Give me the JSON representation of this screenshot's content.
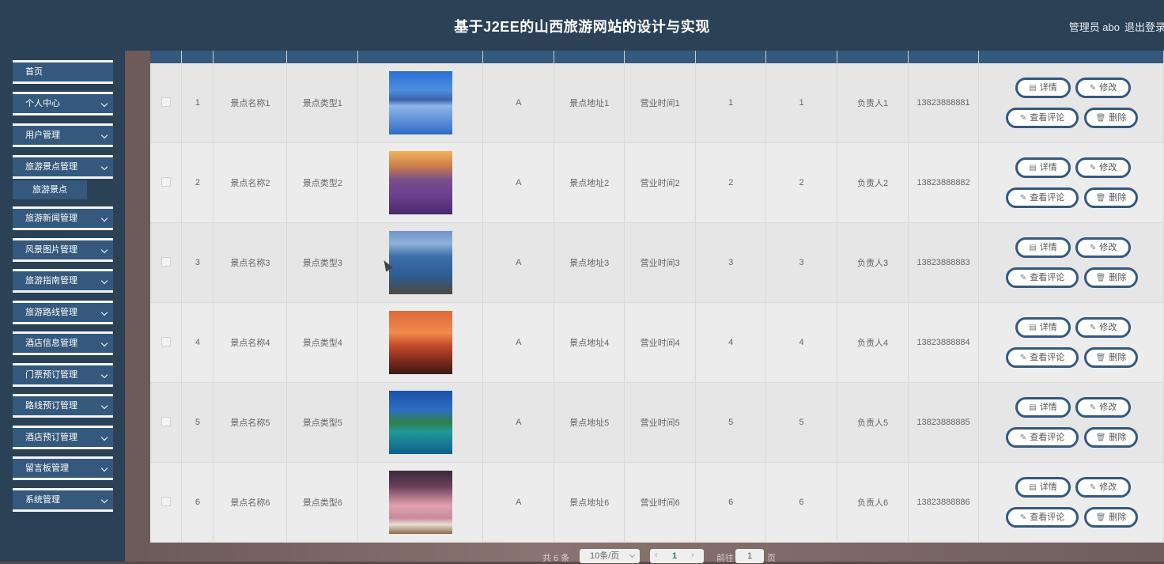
{
  "header": {
    "title": "基于J2EE的山西旅游网站的设计与实现",
    "admin_label": "管理员 abo",
    "logout_label": "退出登录"
  },
  "sidebar": {
    "items": [
      {
        "label": "首页",
        "expandable": false
      },
      {
        "label": "个人中心",
        "expandable": true
      },
      {
        "label": "用户管理",
        "expandable": true
      },
      {
        "label": "旅游景点管理",
        "expandable": true
      },
      {
        "label": "旅游新闻管理",
        "expandable": true
      },
      {
        "label": "风景图片管理",
        "expandable": true
      },
      {
        "label": "旅游指南管理",
        "expandable": true
      },
      {
        "label": "旅游路线管理",
        "expandable": true
      },
      {
        "label": "酒店信息管理",
        "expandable": true
      },
      {
        "label": "门票预订管理",
        "expandable": true
      },
      {
        "label": "路线预订管理",
        "expandable": true
      },
      {
        "label": "酒店预订管理",
        "expandable": true
      },
      {
        "label": "留言板管理",
        "expandable": true
      },
      {
        "label": "系统管理",
        "expandable": true
      }
    ],
    "active_sub": "旅游景点"
  },
  "table": {
    "rows": [
      {
        "idx": "1",
        "name": "景点名称1",
        "type": "景点类型1",
        "level": "A",
        "address": "景点地址1",
        "hours": "营业时间1",
        "c1": "1",
        "c2": "1",
        "owner": "负责人1",
        "phone": "13823888881",
        "image": "lake-tree"
      },
      {
        "idx": "2",
        "name": "景点名称2",
        "type": "景点类型2",
        "level": "A",
        "address": "景点地址2",
        "hours": "营业时间2",
        "c1": "2",
        "c2": "2",
        "owner": "负责人2",
        "phone": "13823888882",
        "image": "lavender-sunset"
      },
      {
        "idx": "3",
        "name": "景点名称3",
        "type": "景点类型3",
        "level": "A",
        "address": "景点地址3",
        "hours": "营业时间3",
        "c1": "3",
        "c2": "3",
        "owner": "负责人3",
        "phone": "13823888883",
        "image": "coastal-lake"
      },
      {
        "idx": "4",
        "name": "景点名称4",
        "type": "景点类型4",
        "level": "A",
        "address": "景点地址4",
        "hours": "营业时间4",
        "c1": "4",
        "c2": "4",
        "owner": "负责人4",
        "phone": "13823888884",
        "image": "red-sunset-tree"
      },
      {
        "idx": "5",
        "name": "景点名称5",
        "type": "景点类型5",
        "level": "A",
        "address": "景点地址5",
        "hours": "营业时间5",
        "c1": "5",
        "c2": "5",
        "owner": "负责人5",
        "phone": "13823888885",
        "image": "tropical-island"
      },
      {
        "idx": "6",
        "name": "景点名称6",
        "type": "景点类型6",
        "level": "A",
        "address": "景点地址6",
        "hours": "营业时间6",
        "c1": "6",
        "c2": "6",
        "owner": "负责人6",
        "phone": "13823888886",
        "image": "pink-clouds-painting"
      }
    ],
    "actions": {
      "detail": "详情",
      "edit": "修改",
      "comments": "查看评论",
      "delete": "删除"
    }
  },
  "pagination": {
    "total": "共 6 条",
    "page_size": "10条/页",
    "current": "1",
    "goto_label": "前往",
    "goto_value": "1",
    "page_unit": "页"
  },
  "colors": {
    "header_bg": "#2b4156",
    "menu_bg": "#35597d",
    "accent": "#35597d"
  },
  "images": {
    "lake-tree": "linear-gradient(180deg,#2c6fd1 0%,#4f8fe0 30%,#3a64a8 45%,#8fb6e8 55%,#2f6bc7 100%)",
    "lavender-sunset": "linear-gradient(180deg,#f3b35a 0%,#c77a4a 25%,#7a4f8a 45%,#6b3f8f 70%,#4a2a6b 100%)",
    "coastal-lake": "linear-gradient(180deg,#6f95c9 0%,#8fb0d8 20%,#3d6fa8 40%,#2d5d93 70%,#4a4a3f 100%)",
    "red-sunset-tree": "linear-gradient(180deg,#e0693a 0%,#f08a4a 35%,#c24a2a 55%,#7a2a1a 80%,#3a1a12 100%)",
    "tropical-island": "linear-gradient(180deg,#1c4fa8 0%,#2f6ec0 30%,#2e7f4a 50%,#1f9a9a 65%,#0f5f8a 100%)",
    "pink-clouds-painting": "linear-gradient(180deg,#3a2a3a 0%,#6b3f5a 25%,#e0a0b0 55%,#c98a9a 75%,#e8e0d8 85%,#8a6a4a 100%)"
  }
}
